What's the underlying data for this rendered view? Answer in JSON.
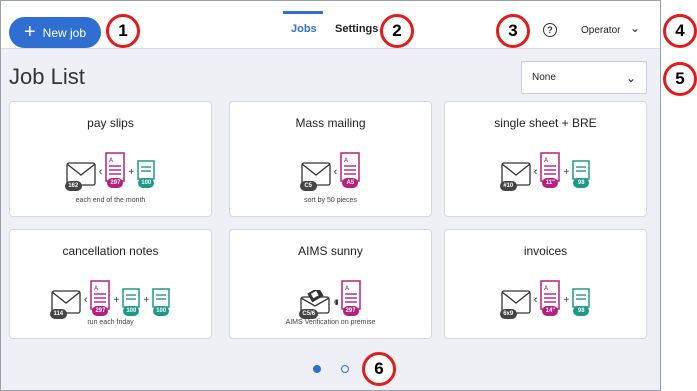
{
  "header": {
    "new_job_label": "New job",
    "tabs": [
      {
        "label": "Jobs"
      },
      {
        "label": "Settings"
      }
    ],
    "operator_label": "Operator"
  },
  "page": {
    "title": "Job List",
    "filter_value": "None"
  },
  "jobs": [
    {
      "title": "pay slips",
      "note": "each end of the month",
      "envelope": "162",
      "insert": "297",
      "extra": [
        "100"
      ]
    },
    {
      "title": "Mass mailing",
      "note": "sort by 50 pieces",
      "envelope": "C5",
      "insert": "A5",
      "extra": []
    },
    {
      "title": "single sheet + BRE",
      "note": "",
      "envelope": "#10",
      "insert": "11\"",
      "extra": [
        "98"
      ]
    },
    {
      "title": "cancellation notes",
      "note": "run each friday",
      "envelope": "114",
      "insert": "297",
      "extra": [
        "100",
        "100"
      ]
    },
    {
      "title": "AIMS sunny",
      "note": "AIMS Verification on premise",
      "envelope": "C5/6",
      "insert": "297",
      "extra": []
    },
    {
      "title": "invoices",
      "note": "",
      "envelope": "6x9",
      "insert": "14\"",
      "extra": [
        "98"
      ]
    }
  ],
  "pagination": {
    "current": 1,
    "total": 2
  },
  "callouts": [
    "1",
    "2",
    "3",
    "4",
    "5",
    "6"
  ],
  "colors": {
    "accent": "#2f6fd1",
    "insert": "#b5207f",
    "extra": "#1d9a86",
    "callout": "#e21b1b"
  }
}
